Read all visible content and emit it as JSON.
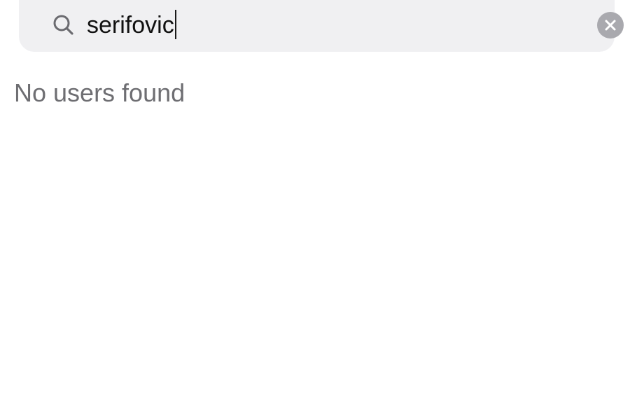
{
  "search": {
    "value": "serifovic",
    "icon": "search-icon",
    "clear_icon": "clear-icon"
  },
  "results": {
    "empty_message": "No users found"
  },
  "colors": {
    "search_bar_background": "#f0f0f2",
    "clear_button": "#a9a9ae",
    "empty_text": "#6e6e72",
    "input_text": "#111111"
  }
}
